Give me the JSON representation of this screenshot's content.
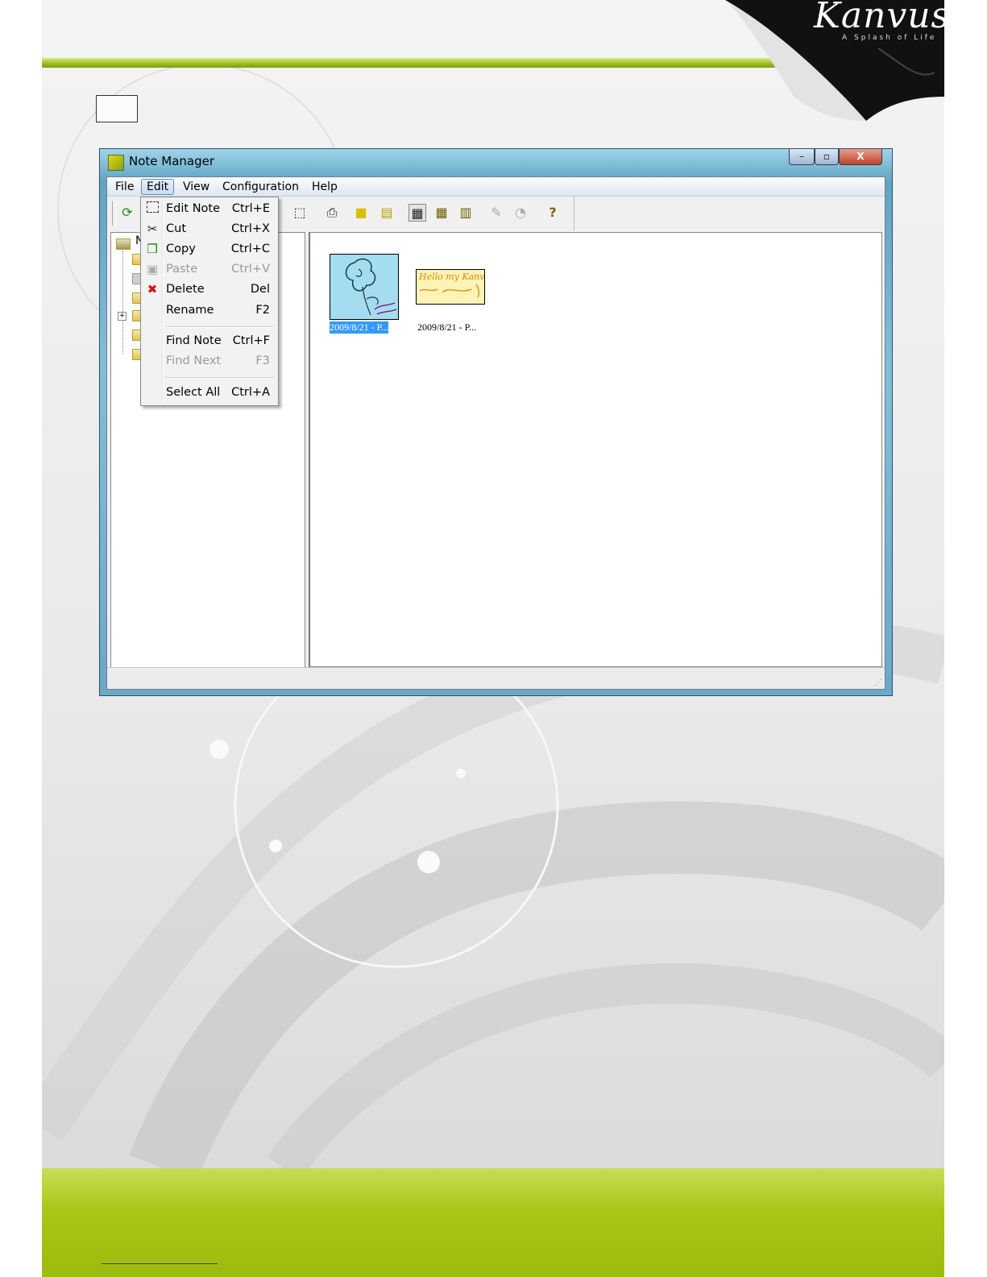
{
  "brand": {
    "logo": "Kanvus",
    "tagline": "A Splash of Life"
  },
  "window": {
    "title": "Note Manager",
    "controls": {
      "minimize": "–",
      "maximize": "▫",
      "close": "X"
    }
  },
  "menubar": {
    "items": [
      {
        "label": "File"
      },
      {
        "label": "Edit"
      },
      {
        "label": "View"
      },
      {
        "label": "Configuration"
      },
      {
        "label": "Help"
      }
    ]
  },
  "edit_menu": {
    "items": [
      {
        "label": "Edit Note",
        "shortcut": "Ctrl+E",
        "enabled": true,
        "icon": "dashed-rect-icon"
      },
      {
        "label": "Cut",
        "shortcut": "Ctrl+X",
        "enabled": true,
        "icon": "scissors-icon"
      },
      {
        "label": "Copy",
        "shortcut": "Ctrl+C",
        "enabled": true,
        "icon": "copy-icon"
      },
      {
        "label": "Paste",
        "shortcut": "Ctrl+V",
        "enabled": false,
        "icon": "paste-icon"
      },
      {
        "label": "Delete",
        "shortcut": "Del",
        "enabled": true,
        "icon": "delete-icon"
      },
      {
        "label": "Rename",
        "shortcut": "F2",
        "enabled": true
      },
      {
        "label": "Find Note",
        "shortcut": "Ctrl+F",
        "enabled": true
      },
      {
        "label": "Find Next",
        "shortcut": "F3",
        "enabled": false
      },
      {
        "label": "Select All",
        "shortcut": "Ctrl+A",
        "enabled": true
      }
    ]
  },
  "tree": {
    "root_label": "N"
  },
  "notes": [
    {
      "label": "2009/8/21 - P...",
      "selected": true
    },
    {
      "label": "2009/8/21 - P...",
      "selected": false,
      "text": "Hello my Kanvus"
    }
  ]
}
